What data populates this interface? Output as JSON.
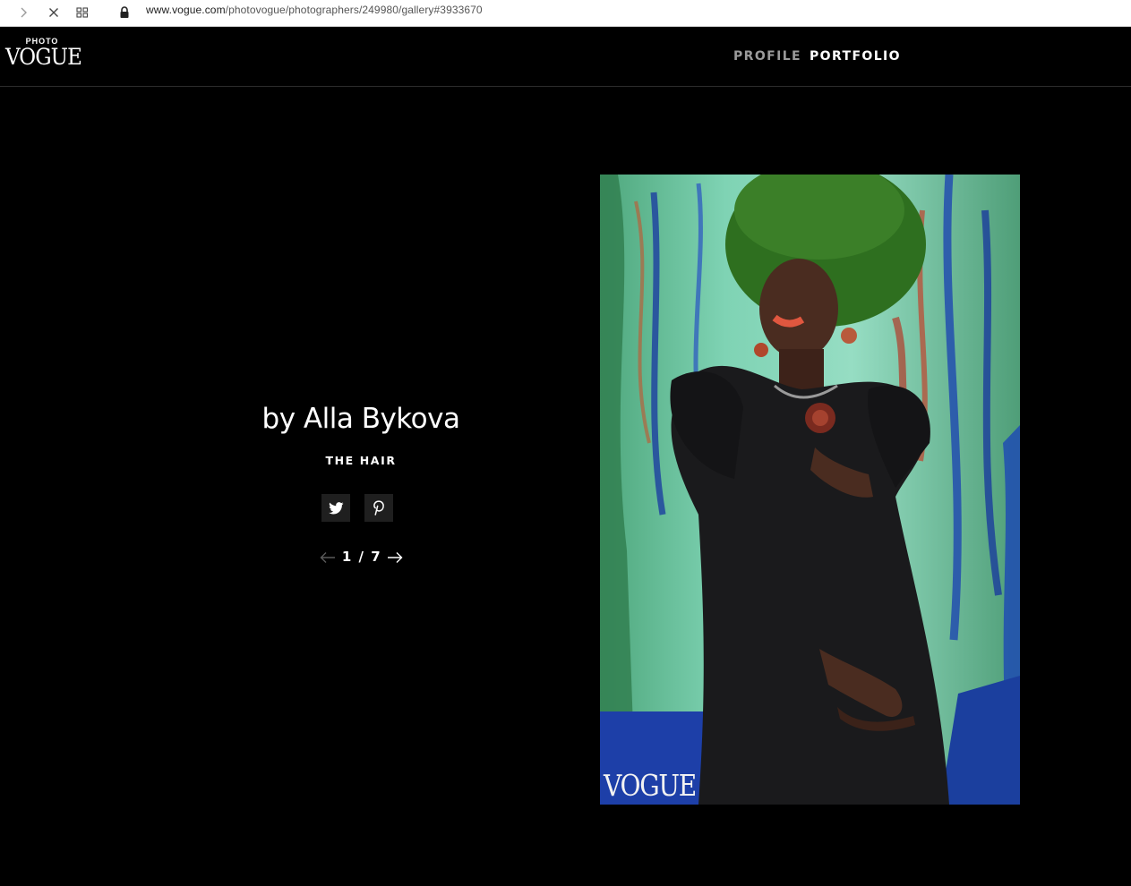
{
  "browser": {
    "url_host": "www.vogue.com",
    "url_path": "/photovogue/photographers/249980/gallery#3933670"
  },
  "header": {
    "logo_top": "PHOTO",
    "logo_main": "VOGUE",
    "nav": {
      "profile": "PROFILE",
      "portfolio": "PORTFOLIO"
    }
  },
  "gallery": {
    "title": "by Alla Bykova",
    "subtitle": "THE HAIR",
    "pager": "1 / 7",
    "photo_watermark": "VOGUE"
  },
  "icons": {
    "forward": "chevron-right-icon",
    "stop": "close-icon",
    "apps": "grid-icon",
    "secure": "lock-icon",
    "twitter": "twitter-icon",
    "pinterest": "pinterest-icon",
    "prev": "arrow-left-icon",
    "next": "arrow-right-icon"
  },
  "colors": {
    "background": "#000000",
    "nav_inactive": "#9b9b9b",
    "share_button_bg": "#1f1f1f"
  }
}
